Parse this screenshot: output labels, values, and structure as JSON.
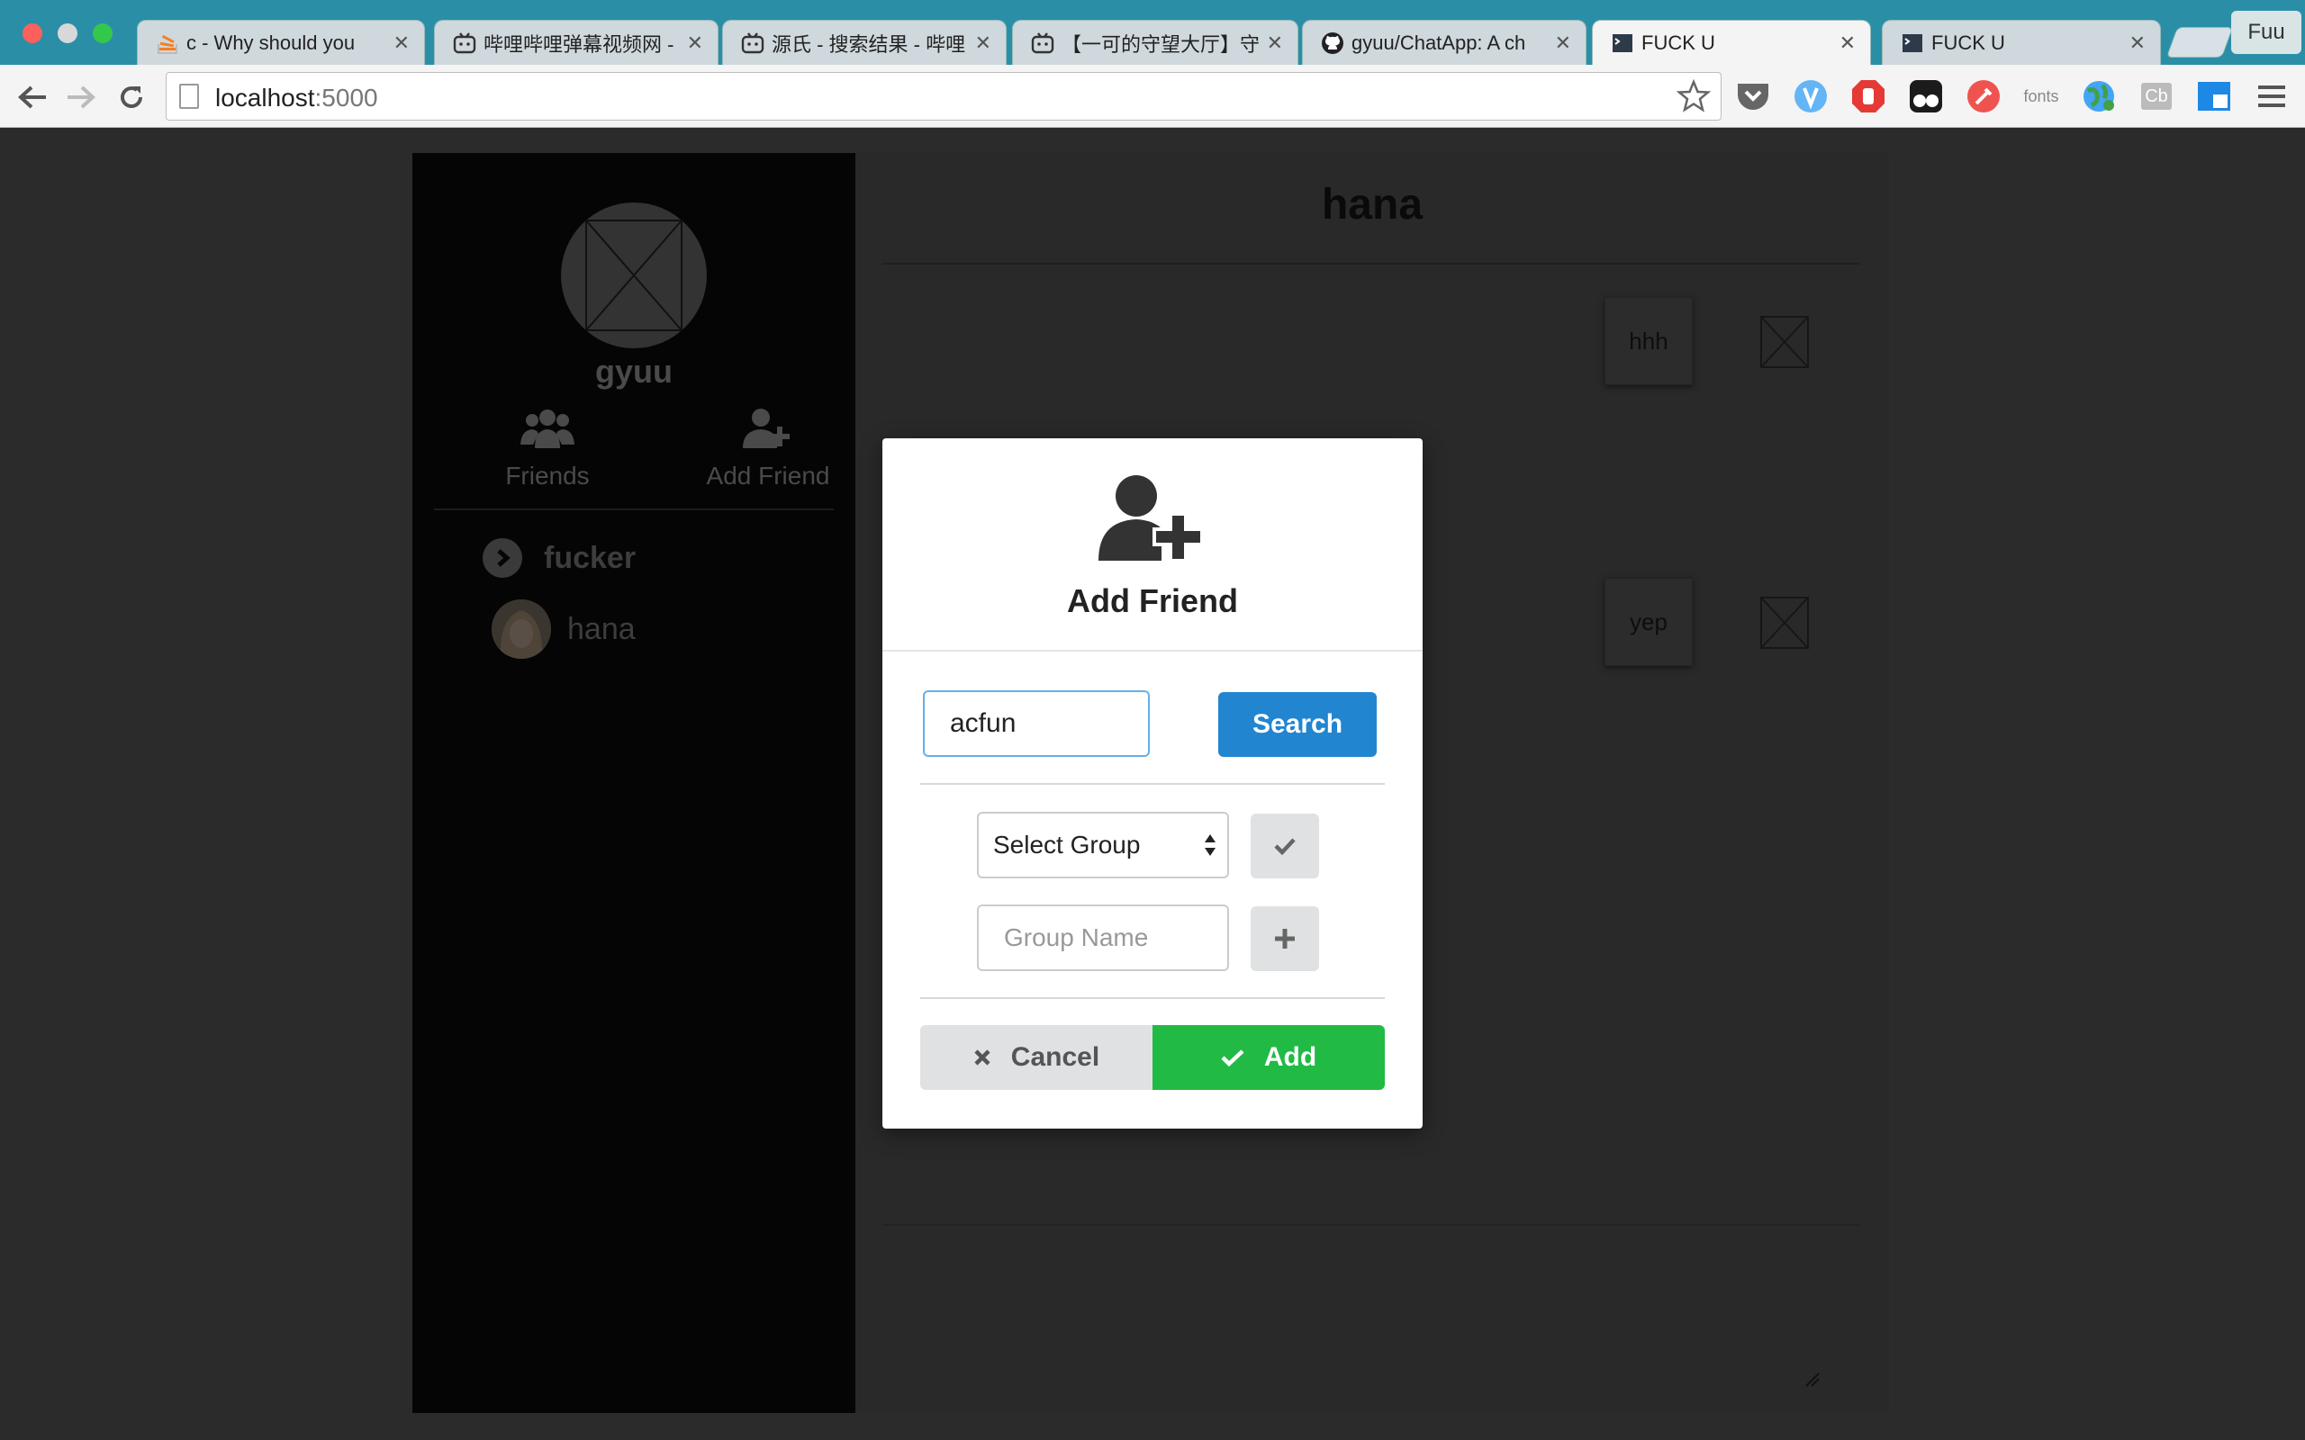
{
  "browser": {
    "tabs": [
      {
        "title": "c - Why should you",
        "icon": "stackoverflow-icon"
      },
      {
        "title": "哔哩哔哩弹幕视频网 -",
        "icon": "bilibili-icon"
      },
      {
        "title": "源氏 - 搜索结果 - 哔哩",
        "icon": "bilibili-icon"
      },
      {
        "title": "【一可的守望大厅】守",
        "icon": "bilibili-icon"
      },
      {
        "title": "gyuu/ChatApp: A ch",
        "icon": "github-icon"
      },
      {
        "title": "FUCK U",
        "icon": "terminal-icon"
      },
      {
        "title": "FUCK U",
        "icon": "terminal-icon"
      }
    ],
    "active_tab": 5,
    "profile_label": "Fuu",
    "url_host": "localhost",
    "url_port": ":5000",
    "extensions": [
      "pocket-icon",
      "vimium-icon",
      "adblock-icon",
      "tampermonkey-icon",
      "dev-tools-icon",
      "fonts-icon",
      "globe-icon",
      "cb-icon",
      "window-icon",
      "menu-icon"
    ],
    "fonts_ext_label": "fonts",
    "cb_ext_label": "Cb"
  },
  "sidebar": {
    "username": "gyuu",
    "nav": [
      {
        "label": "Friends",
        "icon": "users-icon"
      },
      {
        "label": "Add Friend",
        "icon": "add-user-icon"
      }
    ],
    "group_name": "fucker",
    "friend_name": "hana"
  },
  "chat": {
    "title": "hana",
    "messages": [
      "hhh",
      "yep"
    ]
  },
  "modal": {
    "title": "Add Friend",
    "search_value": "acfun",
    "search_button": "Search",
    "select_label": "Select Group",
    "group_name_placeholder": "Group Name",
    "cancel_label": "Cancel",
    "add_label": "Add"
  },
  "colors": {
    "primary": "#2185d0",
    "success": "#21ba45",
    "browser_frame": "#2a8fa6"
  }
}
